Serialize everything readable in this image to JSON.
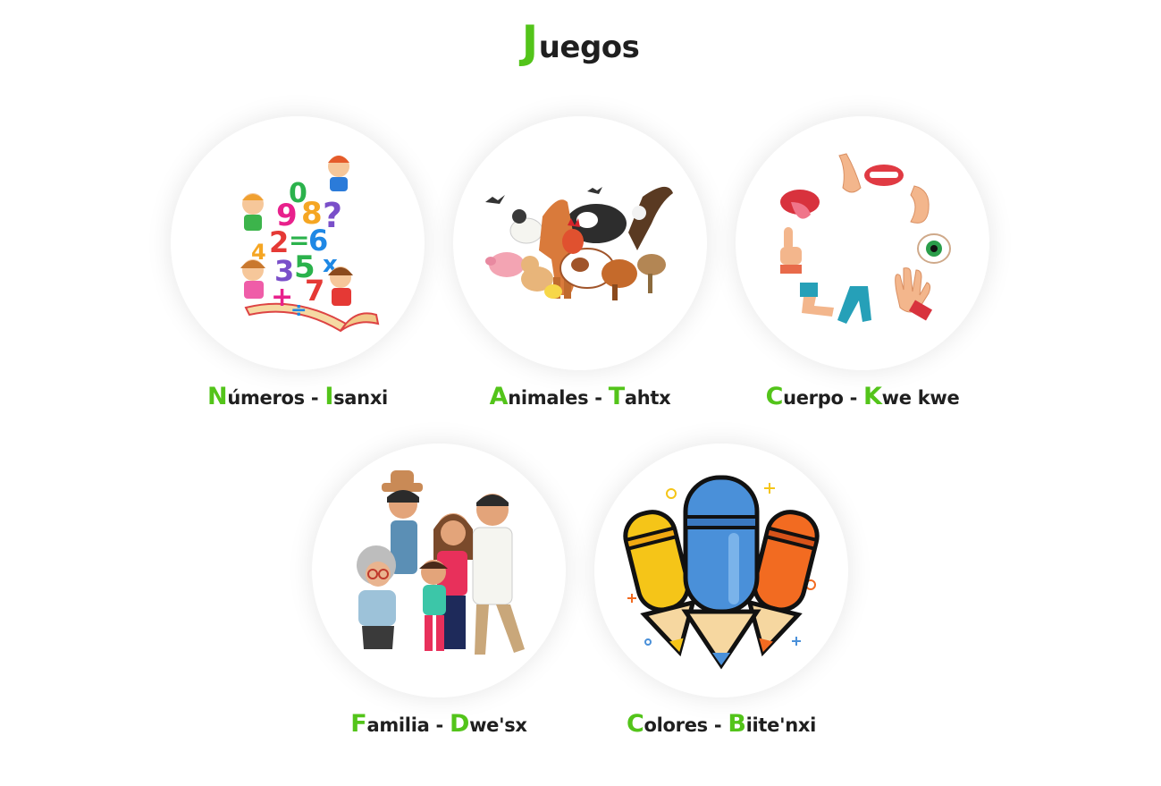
{
  "page": {
    "title_initial": "J",
    "title_rest": "uegos"
  },
  "accent_color": "#53c41a",
  "games": [
    {
      "image_icon": "numbers-illustration",
      "label_a_initial": "N",
      "label_a_rest": "úmeros",
      "separator": " - ",
      "label_b_initial": "I",
      "label_b_rest": "sanxi"
    },
    {
      "image_icon": "animals-illustration",
      "label_a_initial": "A",
      "label_a_rest": "nimales",
      "separator": " - ",
      "label_b_initial": "T",
      "label_b_rest": "ahtx"
    },
    {
      "image_icon": "body-parts-illustration",
      "label_a_initial": "C",
      "label_a_rest": "uerpo",
      "separator": " - ",
      "label_b_initial": "K",
      "label_b_rest": "we kwe"
    },
    {
      "image_icon": "family-illustration",
      "label_a_initial": "F",
      "label_a_rest": "amilia",
      "separator": " - ",
      "label_b_initial": "D",
      "label_b_rest": "we'sx"
    },
    {
      "image_icon": "colored-pencils-illustration",
      "label_a_initial": "C",
      "label_a_rest": "olores",
      "separator": " - ",
      "label_b_initial": "B",
      "label_b_rest": "iite'nxi"
    }
  ],
  "number_glyphs": [
    "0",
    "9",
    "8",
    "2",
    "?",
    "2",
    "=",
    "6",
    "4",
    "3",
    "5",
    "x",
    "7",
    "+",
    "÷"
  ]
}
